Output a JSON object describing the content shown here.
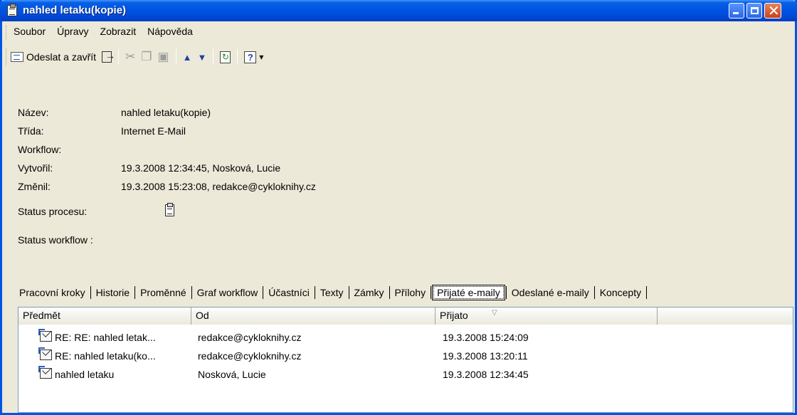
{
  "window": {
    "title": "nahled letaku(kopie)"
  },
  "menu": {
    "items": [
      {
        "label": "Soubor"
      },
      {
        "label": "Úpravy"
      },
      {
        "label": "Zobrazit"
      },
      {
        "label": "Nápověda"
      }
    ]
  },
  "toolbar": {
    "send_close_label": "Odeslat a zavřít"
  },
  "properties": [
    {
      "label": "Název:",
      "value": "nahled letaku(kopie)"
    },
    {
      "label": "Třída:",
      "value": "Internet E-Mail"
    },
    {
      "label": "Workflow:",
      "value": ""
    },
    {
      "label": "Vytvořil:",
      "value": "19.3.2008 12:34:45, Nosková, Lucie"
    },
    {
      "label": "Změnil:",
      "value": "19.3.2008 15:23:08, redakce@cykloknihy.cz"
    },
    {
      "label": "Status procesu:",
      "value": ""
    },
    {
      "label": "Status workflow :",
      "value": ""
    }
  ],
  "tabs": [
    {
      "label": "Pracovní kroky"
    },
    {
      "label": "Historie"
    },
    {
      "label": "Proměnné"
    },
    {
      "label": "Graf workflow"
    },
    {
      "label": "Účastníci"
    },
    {
      "label": "Texty"
    },
    {
      "label": "Zámky"
    },
    {
      "label": "Přílohy"
    },
    {
      "label": "Přijaté e-maily",
      "active": true
    },
    {
      "label": "Odeslané e-maily"
    },
    {
      "label": "Koncepty"
    }
  ],
  "list": {
    "columns": [
      "Předmět",
      "Od",
      "Přijato"
    ],
    "rows": [
      {
        "subject": "RE: RE: nahled letak...",
        "from": "redakce@cykloknihy.cz",
        "received": "19.3.2008 15:24:09"
      },
      {
        "subject": "RE: nahled letaku(ko...",
        "from": "redakce@cykloknihy.cz",
        "received": "19.3.2008 13:20:11"
      },
      {
        "subject": "nahled letaku",
        "from": "Nosková, Lucie",
        "received": "19.3.2008 12:34:45"
      }
    ]
  }
}
